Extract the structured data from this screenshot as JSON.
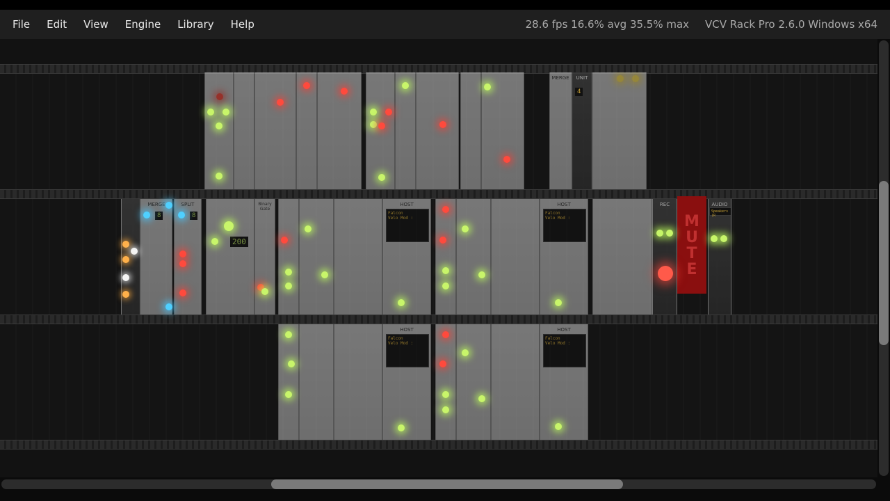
{
  "menu": {
    "items": [
      "File",
      "Edit",
      "View",
      "Engine",
      "Library",
      "Help"
    ]
  },
  "status": {
    "stats": "28.6 fps  16.6% avg  35.5% max",
    "version": "VCV Rack Pro 2.6.0 Windows x64"
  },
  "modules": {
    "merge_label": "MERGE",
    "split_label": "SPLIT",
    "merge_channels": "8",
    "split_channels": "8",
    "clock_display": "200",
    "binary_gate_label": "Binary Gate",
    "host_label": "HOST",
    "host_plugin_name": "Falcon",
    "host_param_text": "Velo Mod :",
    "merge2_label": "MERGE",
    "unit_label": "UNIT",
    "unit_display": "4",
    "rec_label": "REC",
    "mute_text": "MUTE",
    "audio_label": "AUDIO",
    "audio_device": "Speakers (R"
  },
  "colors": {
    "menubar_bg": "#1f1f1f",
    "rack_bg": "#121212",
    "led_green": "#c8f56a",
    "led_red": "#ff4a3d",
    "led_blue": "#4fd0ff",
    "mute_red": "#8a0f0f"
  }
}
